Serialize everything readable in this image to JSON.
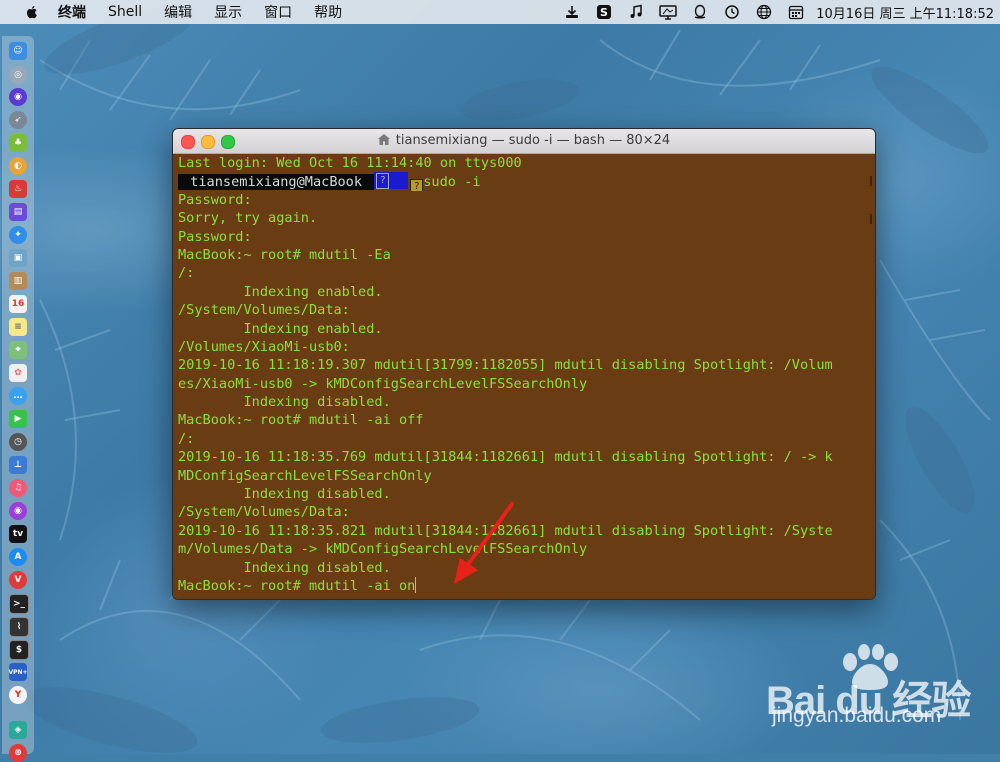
{
  "menubar": {
    "app_name": "终端",
    "items": [
      "Shell",
      "编辑",
      "显示",
      "窗口",
      "帮助"
    ],
    "clock": "10月16日 周三 上午11:18:52",
    "status_icons": [
      "download-icon",
      "sogou-input-icon",
      "music-icon",
      "display-icon",
      "qq-icon",
      "timemachine-icon",
      "globe-icon",
      "calendar-icon"
    ]
  },
  "dock": {
    "icons": [
      "finder-icon",
      "launchpad-icon",
      "siri-icon",
      "rocket-icon",
      "android-icon",
      "chrome-icon",
      "app-icon",
      "app-icon",
      "safari-icon",
      "preview-icon",
      "contacts-icon",
      "calendar-icon",
      "notes-icon",
      "maps-icon",
      "photos-icon",
      "messages-icon",
      "facetime-icon",
      "timemachine-icon",
      "keynote-icon",
      "music-icon",
      "podcasts-icon",
      "appletv-icon",
      "appstore-icon",
      "vivaldi-icon",
      "terminal-icon",
      "activity-monitor-icon",
      "terminal-icon",
      "vpn-icon",
      "yandex-icon",
      "app-icon",
      "app-icon"
    ],
    "vpn_label": "VPN+"
  },
  "window": {
    "title": "tiansemixiang — sudo -i — bash — 80×24",
    "prompt_user": " tiansemixiang@MacBook ",
    "prompt_glyph": "?",
    "prompt_cmd": "sudo -i",
    "lines": [
      "Last login: Wed Oct 16 11:14:40 on ttys000",
      "Password:",
      "Sorry, try again.",
      "Password:",
      "MacBook:~ root# mdutil -Ea",
      "/:",
      "        Indexing enabled.",
      "/System/Volumes/Data:",
      "        Indexing enabled.",
      "/Volumes/XiaoMi-usb0:",
      "2019-10-16 11:18:19.307 mdutil[31799:1182055] mdutil disabling Spotlight: /Volum",
      "es/XiaoMi-usb0 -> kMDConfigSearchLevelFSSearchOnly",
      "        Indexing disabled.",
      "MacBook:~ root# mdutil -ai off",
      "/:",
      "2019-10-16 11:18:35.769 mdutil[31844:1182661] mdutil disabling Spotlight: / -> k",
      "MDConfigSearchLevelFSSearchOnly",
      "        Indexing disabled.",
      "/System/Volumes/Data:",
      "2019-10-16 11:18:35.821 mdutil[31844:1182661] mdutil disabling Spotlight: /Syste",
      "m/Volumes/Data -> kMDConfigSearchLevelFSSearchOnly",
      "        Indexing disabled.",
      "MacBook:~ root# mdutil -ai on"
    ]
  },
  "watermark": {
    "logo": "Bai du 经验",
    "url": "jingyan.baidu.com"
  },
  "colors": {
    "terminal_bg": "#693c14",
    "terminal_fg": "#8be041",
    "arrow": "#e8221b"
  }
}
